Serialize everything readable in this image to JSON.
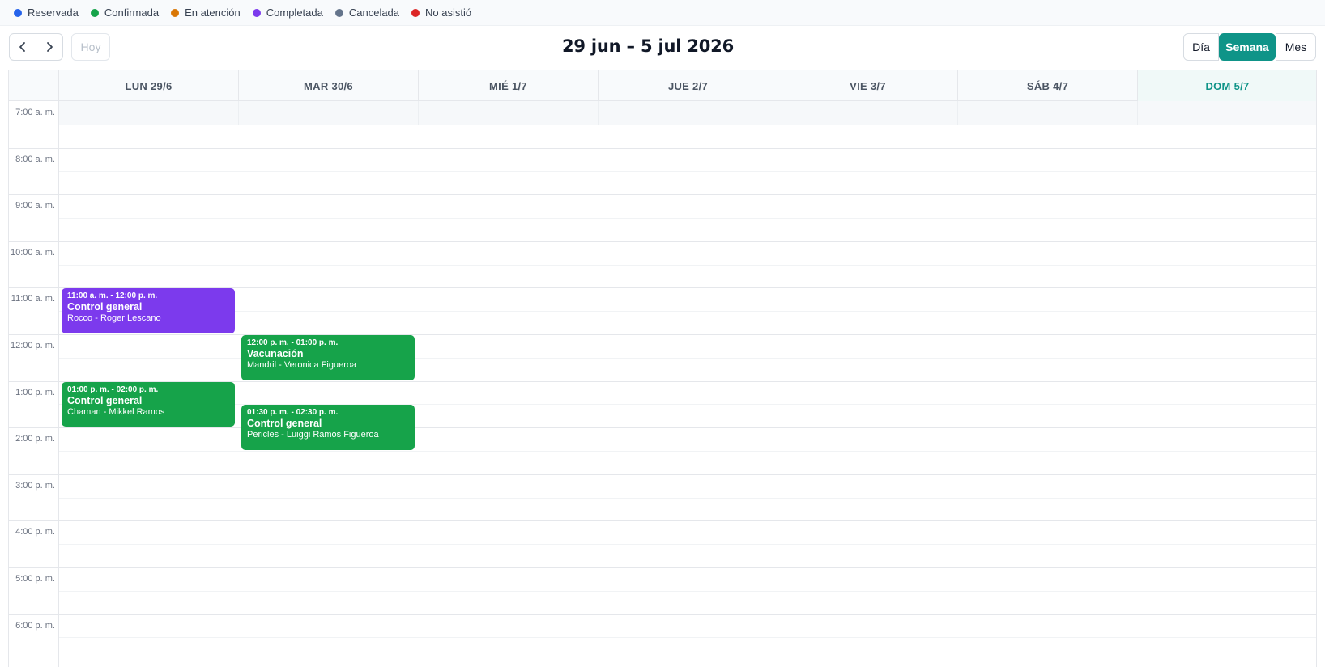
{
  "legend": [
    {
      "label": "Reservada",
      "color": "#2563eb"
    },
    {
      "label": "Confirmada",
      "color": "#16a34a"
    },
    {
      "label": "En atención",
      "color": "#d97706"
    },
    {
      "label": "Completada",
      "color": "#7c3aed"
    },
    {
      "label": "Cancelada",
      "color": "#64748b"
    },
    {
      "label": "No asistió",
      "color": "#dc2626"
    }
  ],
  "toolbar": {
    "prev_icon": "chevron-left-icon",
    "next_icon": "chevron-right-icon",
    "today_label": "Hoy",
    "title": "29 jun – 5 jul 2026",
    "views": {
      "day": "Día",
      "week": "Semana",
      "month": "Mes"
    },
    "active_view": "Semana",
    "accent_color": "#0f9488"
  },
  "days": [
    {
      "label": "LUN 29/6",
      "today": false
    },
    {
      "label": "MAR 30/6",
      "today": false
    },
    {
      "label": "MIÉ 1/7",
      "today": false
    },
    {
      "label": "JUE 2/7",
      "today": false
    },
    {
      "label": "VIE 3/7",
      "today": false
    },
    {
      "label": "SÁB 4/7",
      "today": false
    },
    {
      "label": "DOM 5/7",
      "today": true
    }
  ],
  "hours": [
    "7:00 a. m.",
    "8:00 a. m.",
    "9:00 a. m.",
    "10:00 a. m.",
    "11:00 a. m.",
    "12:00 p. m.",
    "1:00 p. m.",
    "2:00 p. m.",
    "3:00 p. m.",
    "4:00 p. m.",
    "5:00 p. m.",
    "6:00 p. m."
  ],
  "events": [
    {
      "day": 0,
      "start": 11.0,
      "end": 12.0,
      "time": "11:00 a. m. - 12:00 p. m.",
      "title": "Control general",
      "subtitle": "Rocco - Roger Lescano",
      "status": "Completada",
      "color": "#7c3aed"
    },
    {
      "day": 1,
      "start": 12.0,
      "end": 13.0,
      "time": "12:00 p. m. - 01:00 p. m.",
      "title": "Vacunación",
      "subtitle": "Mandril - Veronica Figueroa",
      "status": "Confirmada",
      "color": "#16a34a"
    },
    {
      "day": 0,
      "start": 13.0,
      "end": 14.0,
      "time": "01:00 p. m. - 02:00 p. m.",
      "title": "Control general",
      "subtitle": "Chaman - Mikkel Ramos",
      "status": "Confirmada",
      "color": "#16a34a"
    },
    {
      "day": 1,
      "start": 13.5,
      "end": 14.5,
      "time": "01:30 p. m. - 02:30 p. m.",
      "title": "Control general",
      "subtitle": "Pericles - Luiggi Ramos Figueroa",
      "status": "Confirmada",
      "color": "#16a34a"
    }
  ]
}
